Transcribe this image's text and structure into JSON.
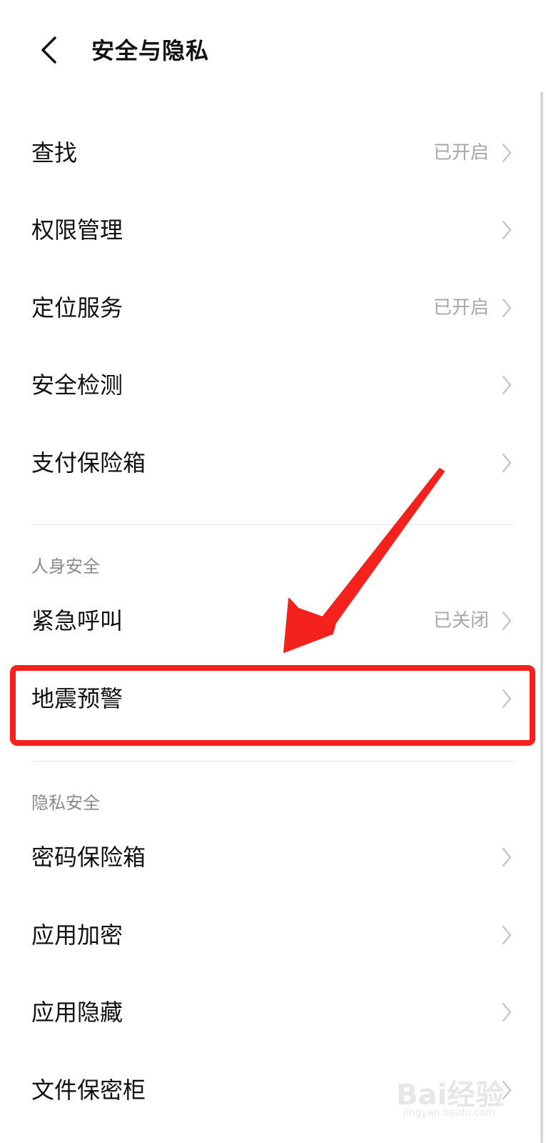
{
  "header": {
    "back_icon": "chevron-left-icon",
    "title": "安全与隐私"
  },
  "rows_main": [
    {
      "label": "查找",
      "status": "已开启"
    },
    {
      "label": "权限管理",
      "status": ""
    },
    {
      "label": "定位服务",
      "status": "已开启"
    },
    {
      "label": "安全检测",
      "status": ""
    },
    {
      "label": "支付保险箱",
      "status": ""
    }
  ],
  "section_personal": {
    "title": "人身安全",
    "rows": [
      {
        "label": "紧急呼叫",
        "status": "已关闭"
      },
      {
        "label": "地震预警",
        "status": ""
      }
    ]
  },
  "section_privacy": {
    "title": "隐私安全",
    "rows": [
      {
        "label": "密码保险箱",
        "status": ""
      },
      {
        "label": "应用加密",
        "status": ""
      },
      {
        "label": "应用隐藏",
        "status": ""
      },
      {
        "label": "文件保密柜",
        "status": ""
      }
    ]
  },
  "annotation": {
    "color": "#f4211c"
  },
  "watermark": {
    "logo_text": "Bai经验",
    "url": "jingyan.baidu.com"
  }
}
